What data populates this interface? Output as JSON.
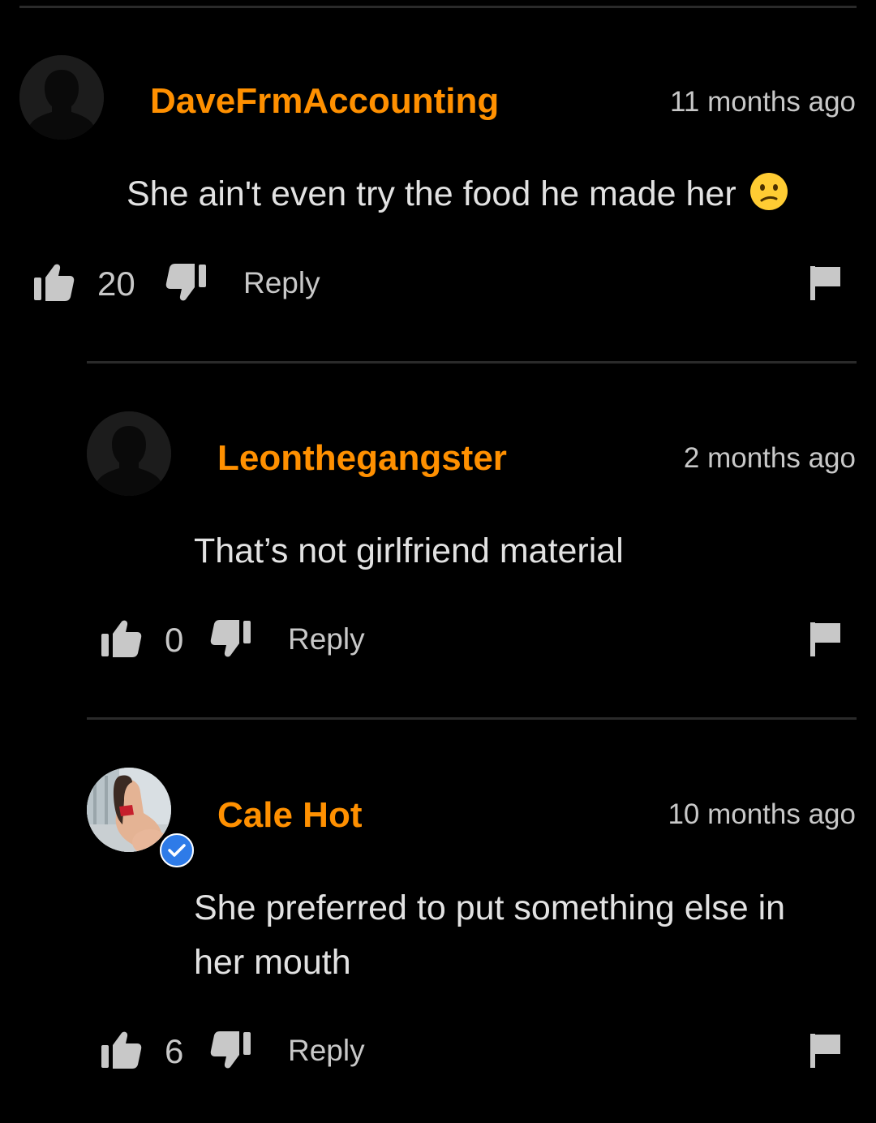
{
  "comments": [
    {
      "username": "DaveFrmAccounting",
      "time": "11 months ago",
      "text": "She ain't even try the food he made her",
      "likes": "20",
      "reply_label": "Reply",
      "verified": false
    },
    {
      "username": "Leonthegangster",
      "time": "2 months ago",
      "text": "That’s not girlfriend material",
      "likes": "0",
      "reply_label": "Reply",
      "verified": false
    },
    {
      "username": "Cale Hot",
      "time": "10 months ago",
      "text": "She preferred to put something else in her mouth",
      "likes": "6",
      "reply_label": "Reply",
      "verified": true
    }
  ],
  "colors": {
    "background": "#000000",
    "username": "#ff9000",
    "divider": "#2a2a2a",
    "verified_badge": "#2e7be8"
  },
  "icons": {
    "like": "thumbs-up-icon",
    "dislike": "thumbs-down-icon",
    "report": "flag-icon",
    "verified": "verified-check-icon",
    "emoji": "confused-face-emoji"
  }
}
